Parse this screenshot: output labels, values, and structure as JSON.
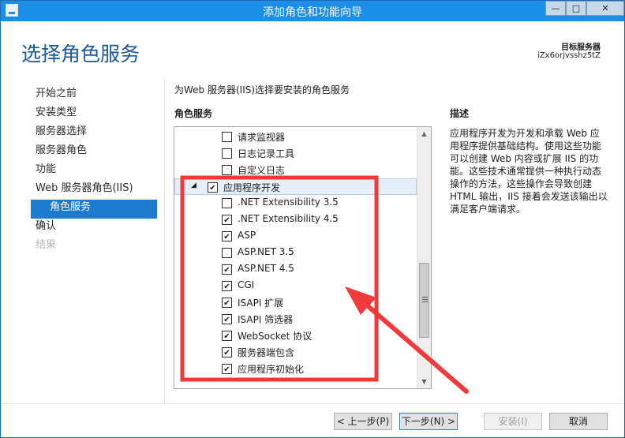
{
  "window": {
    "title": "添加角色和功能向导",
    "controls": {
      "minimize": "—",
      "maximize": "□",
      "close": "✕"
    }
  },
  "header": {
    "page_title": "选择角色服务",
    "target_label": "目标服务器",
    "target_value": "iZx6orjvsshz5tZ"
  },
  "nav": {
    "items": [
      {
        "label": "开始之前",
        "state": "normal"
      },
      {
        "label": "安装类型",
        "state": "normal"
      },
      {
        "label": "服务器选择",
        "state": "normal"
      },
      {
        "label": "服务器角色",
        "state": "normal"
      },
      {
        "label": "功能",
        "state": "normal"
      },
      {
        "label": "Web 服务器角色(IIS)",
        "state": "normal"
      },
      {
        "label": "角色服务",
        "state": "active"
      },
      {
        "label": "确认",
        "state": "normal"
      },
      {
        "label": "结果",
        "state": "disabled"
      }
    ]
  },
  "main": {
    "intro": "为Web 服务器(IIS)选择要安装的角色服务",
    "column_header": "角色服务",
    "tree": [
      {
        "label": "请求监视器",
        "checked": false,
        "level": 2
      },
      {
        "label": "日志记录工具",
        "checked": false,
        "level": 2
      },
      {
        "label": "自定义日志",
        "checked": false,
        "level": 2
      },
      {
        "label": "应用程序开发",
        "checked": true,
        "level": 1,
        "expander": "◢",
        "selected": true
      },
      {
        "label": ".NET Extensibility 3.5",
        "checked": false,
        "level": 2
      },
      {
        "label": ".NET Extensibility 4.5",
        "checked": true,
        "level": 2
      },
      {
        "label": "ASP",
        "checked": true,
        "level": 2
      },
      {
        "label": "ASP.NET 3.5",
        "checked": false,
        "level": 2
      },
      {
        "label": "ASP.NET 4.5",
        "checked": true,
        "level": 2
      },
      {
        "label": "CGI",
        "checked": true,
        "level": 2
      },
      {
        "label": "ISAPI 扩展",
        "checked": true,
        "level": 2
      },
      {
        "label": "ISAPI 筛选器",
        "checked": true,
        "level": 2
      },
      {
        "label": "WebSocket 协议",
        "checked": true,
        "level": 2
      },
      {
        "label": "服务器端包含",
        "checked": true,
        "level": 2
      },
      {
        "label": "应用程序初始化",
        "checked": true,
        "level": 2
      }
    ],
    "scroll": {
      "up": "▲",
      "down": "▼"
    }
  },
  "description": {
    "header": "描述",
    "text": "应用程序开发为开发和承载 Web 应用程序提供基础结构。使用这些功能可以创建 Web 内容或扩展 IIS 的功能。这些技术通常提供一种执行动态操作的方法，这些操作会导致创建 HTML 输出，IIS 接着会发送该输出以满足客户端请求。"
  },
  "footer": {
    "prev": "< 上一步(P)",
    "next": "下一步(N) >",
    "install": "安装(I)",
    "cancel": "取消"
  },
  "colors": {
    "titlebar": "#1b8ee8",
    "nav_active": "#1d7bcf",
    "page_title": "#1c5a96",
    "annotation": "#ef3b3b"
  }
}
